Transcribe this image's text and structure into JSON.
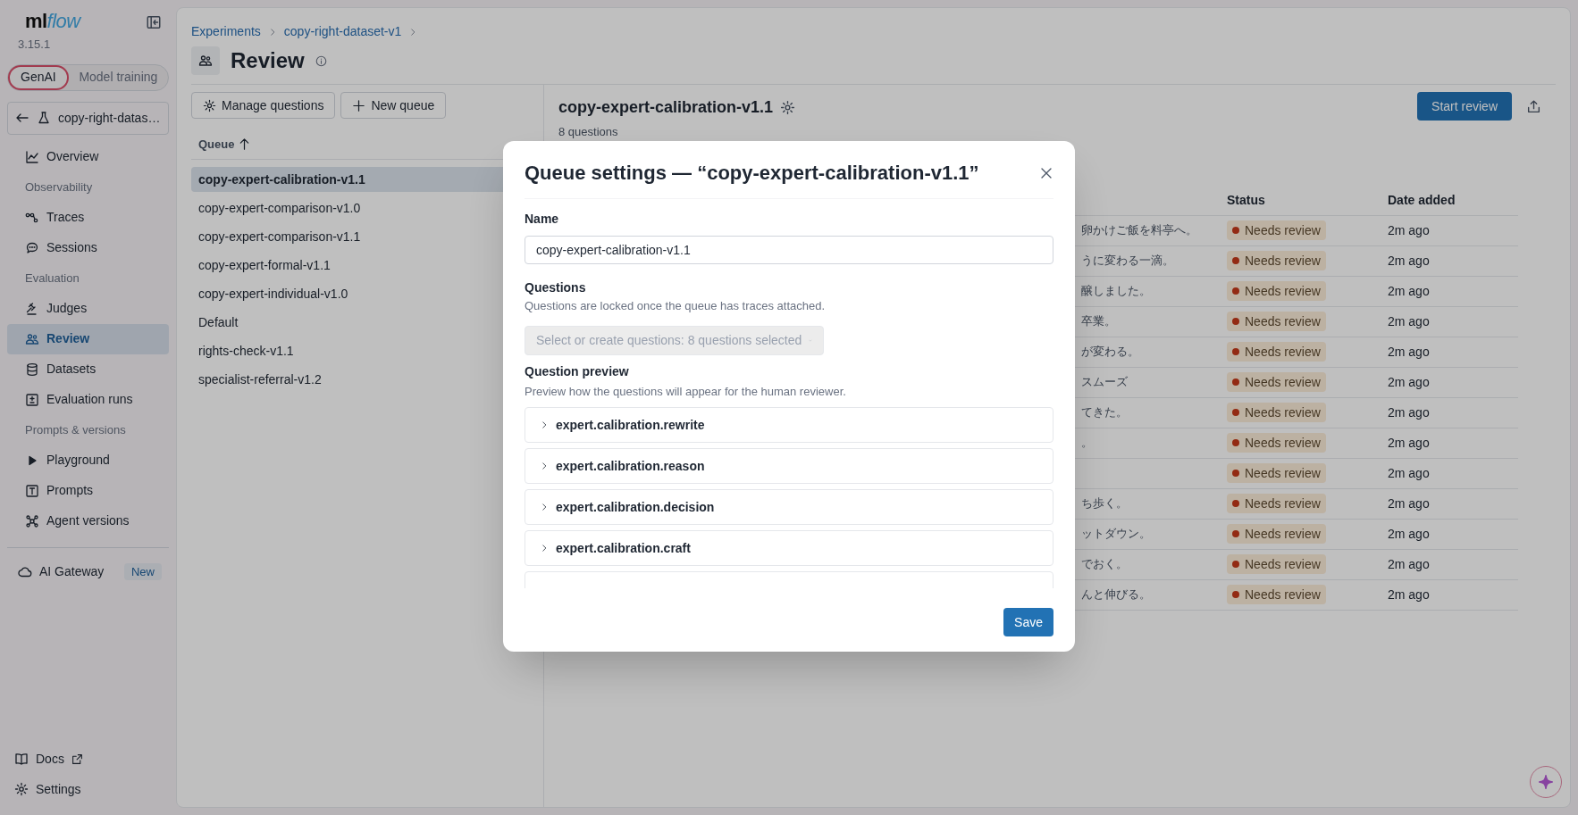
{
  "sidebar": {
    "logo": {
      "prefix": "ml",
      "suffix": "flow"
    },
    "version": "3.15.1",
    "modes": [
      {
        "label": "GenAI",
        "selected": true
      },
      {
        "label": "Model training",
        "selected": false
      }
    ],
    "experiment": "copy-right-datas…",
    "nav": [
      {
        "kind": "item",
        "label": "Overview",
        "selected": false
      },
      {
        "kind": "section",
        "label": "Observability"
      },
      {
        "kind": "item",
        "label": "Traces",
        "selected": false
      },
      {
        "kind": "item",
        "label": "Sessions",
        "selected": false
      },
      {
        "kind": "section",
        "label": "Evaluation"
      },
      {
        "kind": "item",
        "label": "Judges",
        "selected": false
      },
      {
        "kind": "item",
        "label": "Review",
        "selected": true
      },
      {
        "kind": "item",
        "label": "Datasets",
        "selected": false
      },
      {
        "kind": "item",
        "label": "Evaluation runs",
        "selected": false
      },
      {
        "kind": "section",
        "label": "Prompts & versions"
      },
      {
        "kind": "item",
        "label": "Playground",
        "selected": false
      },
      {
        "kind": "item",
        "label": "Prompts",
        "selected": false
      },
      {
        "kind": "item",
        "label": "Agent versions",
        "selected": false
      }
    ],
    "gateway": {
      "label": "AI Gateway",
      "badge": "New"
    },
    "footer": [
      "Docs",
      "Settings"
    ]
  },
  "breadcrumb": [
    "Experiments",
    "copy-right-dataset-v1"
  ],
  "page_title": "Review",
  "toolbar": [
    "Manage questions",
    "New queue"
  ],
  "queue_table": {
    "column": "Queue",
    "rows": [
      {
        "name": "copy-expert-calibration-v1.1",
        "selected": true
      },
      {
        "name": "copy-expert-comparison-v1.0",
        "selected": false
      },
      {
        "name": "copy-expert-comparison-v1.1",
        "selected": false
      },
      {
        "name": "copy-expert-formal-v1.1",
        "selected": false
      },
      {
        "name": "copy-expert-individual-v1.0",
        "selected": false
      },
      {
        "name": "Default",
        "selected": false
      },
      {
        "name": "rights-check-v1.1",
        "selected": false
      },
      {
        "name": "specialist-referral-v1.2",
        "selected": false
      }
    ]
  },
  "detail": {
    "title": "copy-expert-calibration-v1.1",
    "subtitle": "8 questions",
    "start_button": "Start review",
    "columns": [
      "Status",
      "Date added"
    ],
    "rows": [
      {
        "column_1": "卵かけご飯を料亭へ。",
        "status": "Needs review",
        "date": "2m ago"
      },
      {
        "column_1": "うに変わる一滴。",
        "status": "Needs review",
        "date": "2m ago"
      },
      {
        "column_1": "醸しました。",
        "status": "Needs review",
        "date": "2m ago"
      },
      {
        "column_1": "卒業。",
        "status": "Needs review",
        "date": "2m ago"
      },
      {
        "column_1": "が変わる。",
        "status": "Needs review",
        "date": "2m ago"
      },
      {
        "column_1": "スムーズ",
        "status": "Needs review",
        "date": "2m ago"
      },
      {
        "column_1": "てきた。",
        "status": "Needs review",
        "date": "2m ago"
      },
      {
        "column_1": "。",
        "status": "Needs review",
        "date": "2m ago"
      },
      {
        "status": "Needs review",
        "date": "2m ago"
      },
      {
        "column_1": "ち歩く。",
        "status": "Needs review",
        "date": "2m ago"
      },
      {
        "column_1": "ットダウン。",
        "status": "Needs review",
        "date": "2m ago"
      },
      {
        "column_1": "でおく。",
        "status": "Needs review",
        "date": "2m ago"
      },
      {
        "column_1": "んと伸びる。",
        "status": "Needs review",
        "date": "2m ago"
      }
    ]
  },
  "modal": {
    "title": "Queue settings — “copy-expert-calibration-v1.1”",
    "name_label": "Name",
    "name_value": "copy-expert-calibration-v1.1",
    "questions_label": "Questions",
    "questions_hint": "Questions are locked once the queue has traces attached.",
    "questions_select": {
      "value": "Select or create questions: 8 questions selected",
      "disabled": true
    },
    "preview_label": "Question preview",
    "preview_hint": "Preview how the questions will appear for the human reviewer.",
    "questions": [
      {
        "label": "expert.calibration.rewrite",
        "expanded": false
      },
      {
        "label": "expert.calibration.reason",
        "expanded": false
      },
      {
        "label": "expert.calibration.decision",
        "expanded": false
      },
      {
        "label": "expert.calibration.craft",
        "expanded": false
      }
    ],
    "save_button": "Save"
  }
}
